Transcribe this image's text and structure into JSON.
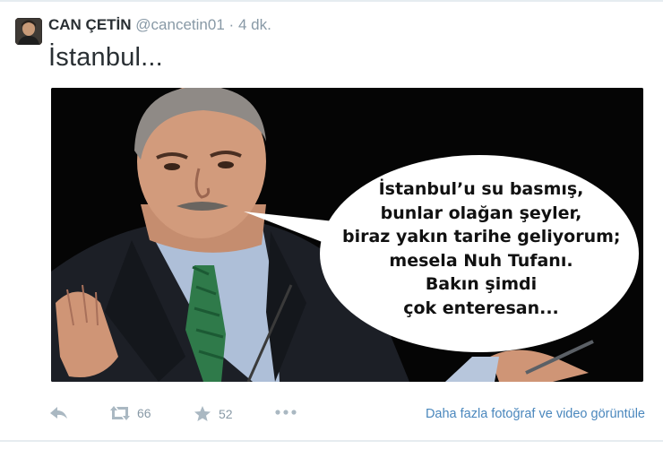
{
  "tweet": {
    "author_name": "CAN ÇETİN",
    "username": "@cancetin01",
    "separator": "·",
    "time": "4 dk.",
    "text": "İstanbul...",
    "bubble_lines": [
      "İstanbul’u su basmış,",
      "bunlar olağan şeyler,",
      "biraz yakın tarihe geliyorum;",
      "mesela Nuh Tufanı.",
      "Bakın şimdi",
      "çok enteresan..."
    ]
  },
  "actions": {
    "reply_icon": "reply-icon",
    "retweet_icon": "retweet-icon",
    "retweet_count": "66",
    "favorite_icon": "star-icon",
    "favorite_count": "52",
    "more_icon": "more-dots-icon",
    "media_link": "Daha fazla fotoğraf ve video görüntüle"
  },
  "colors": {
    "text": "#292f33",
    "muted": "#8899a6",
    "link": "#4a87bd",
    "divider": "#e6ecf0"
  }
}
